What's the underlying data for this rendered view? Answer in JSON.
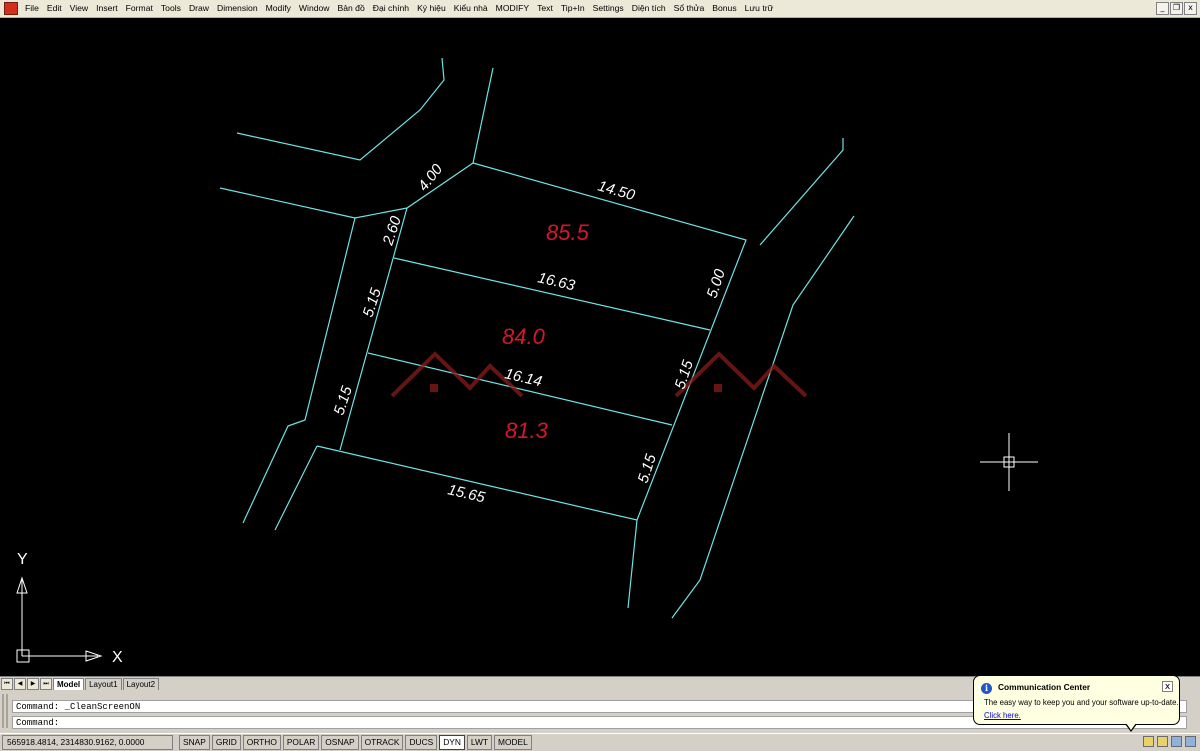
{
  "menubar": {
    "items": [
      "File",
      "Edit",
      "View",
      "Insert",
      "Format",
      "Tools",
      "Draw",
      "Dimension",
      "Modify",
      "Window",
      "Bản đồ",
      "Đại chính",
      "Ký hiệu",
      "Kiểu nhà",
      "MODIFY",
      "Text",
      "Tip+In",
      "Settings",
      "Diện tích",
      "Sổ thửa",
      "Bonus",
      "Lưu trữ"
    ],
    "window_controls": [
      "_",
      "❐",
      "x"
    ]
  },
  "drawing": {
    "dimensions": [
      "4.00",
      "14.50",
      "2.60",
      "16.63",
      "5.00",
      "5.15",
      "5.15",
      "16.14",
      "5.15",
      "5.15",
      "15.65"
    ],
    "areas": [
      "85.5",
      "84.0",
      "81.3"
    ],
    "ucs": {
      "x_label": "X",
      "y_label": "Y"
    }
  },
  "layout_tabs": {
    "nav": [
      "⏮",
      "◀",
      "▶",
      "⏭"
    ],
    "tabs": [
      "Model",
      "Layout1",
      "Layout2"
    ]
  },
  "command": {
    "history": "Command: _CleanScreenON",
    "prompt": "Command:"
  },
  "status": {
    "coords": "565918.4814, 2314830.9162, 0.0000",
    "toggles": [
      "SNAP",
      "GRID",
      "ORTHO",
      "POLAR",
      "OSNAP",
      "OTRACK",
      "DUCS",
      "DYN",
      "LWT",
      "MODEL"
    ]
  },
  "comm_center": {
    "title": "Communication Center",
    "message": "The easy way to keep you and your software up-to-date.",
    "link": "Click here.",
    "close": "x"
  },
  "colors": {
    "canvas": "#000000",
    "boundary": "#6ee3e3",
    "dimension_text": "#ffffff",
    "area_text": "#d4182c"
  }
}
